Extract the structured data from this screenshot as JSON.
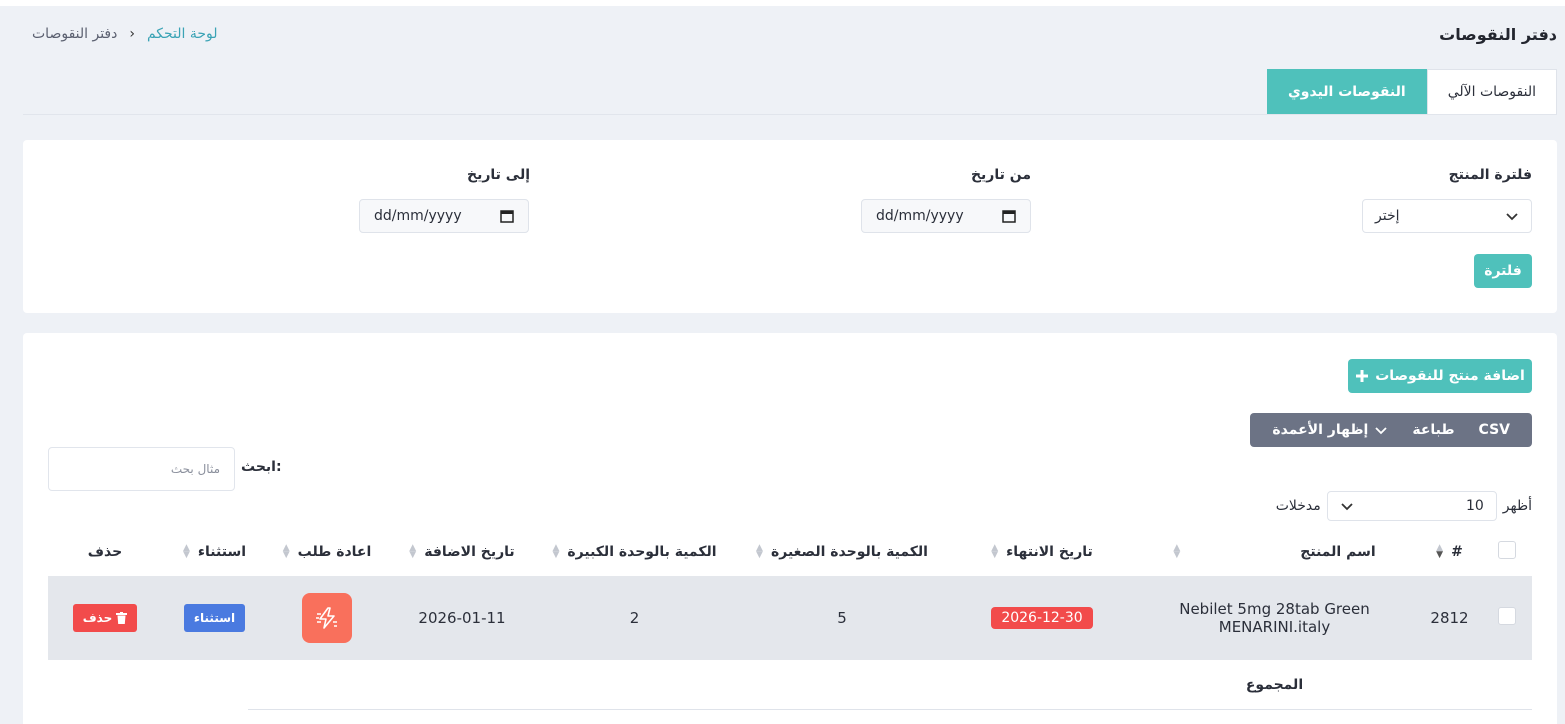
{
  "page": {
    "title": "دفتر النقوصات"
  },
  "breadcrumb": {
    "home": "لوحة التحكم",
    "separator": "›",
    "current": "دفتر النقوصات"
  },
  "tabs": [
    {
      "label": "النقوصات الآلي",
      "active": false
    },
    {
      "label": "النقوصات اليدوي",
      "active": true
    }
  ],
  "filters": {
    "product_label": "فلترة المنتج",
    "product_value": "إختر",
    "from_label": "من تاريخ",
    "from_value": "dd/mm/yyyy",
    "to_label": "إلى تاريخ",
    "to_value": "dd/mm/yyyy",
    "filter_button": "فلترة"
  },
  "actions": {
    "add_button": "اضافة منتج للنقوصات"
  },
  "toolbar": {
    "csv": "CSV",
    "print": "طباعة",
    "columns": "إظهار الأعمدة"
  },
  "search": {
    "label": "ابحث:",
    "placeholder": "مثال بحث"
  },
  "length": {
    "show": "أظهر",
    "value": "10",
    "entries": "مدخلات"
  },
  "table": {
    "headers": {
      "num": "#",
      "product": "اسم المنتج",
      "expiry": "تاريخ الانتهاء",
      "qty_small": "الكمية بالوحدة الصغيرة",
      "qty_large": "الكمية بالوحدة الكبيرة",
      "added": "تاريخ الاضافة",
      "reorder": "اعادة طلب",
      "exclude": "استثناء",
      "delete": "حذف"
    },
    "rows": [
      {
        "num": "2812",
        "product": "Nebilet 5mg 28tab Green MENARINI.italy",
        "expiry": "2026-12-30",
        "qty_small": "5",
        "qty_large": "2",
        "added": "2026-01-11",
        "exclude_label": "استثناء",
        "delete_label": "حذف"
      }
    ],
    "footer": {
      "total": "المجموع"
    }
  },
  "colors": {
    "accent": "#4fc1bb",
    "danger": "#f24b4b",
    "primary": "#4a7ae0",
    "reorder": "#f9705c"
  }
}
